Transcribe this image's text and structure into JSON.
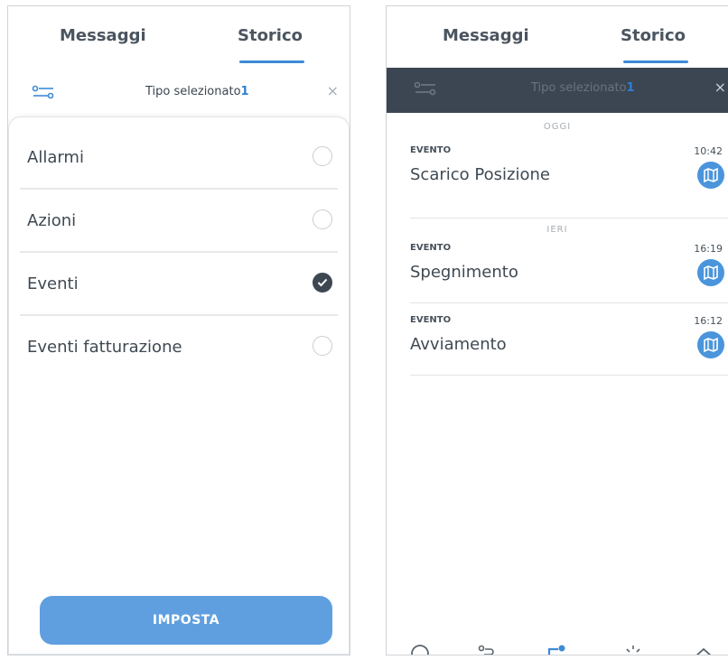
{
  "left": {
    "tabs": [
      {
        "label": "Messaggi"
      },
      {
        "label": "Storico"
      }
    ],
    "filter": {
      "text": "Tipo selezionato",
      "count": "1",
      "close": "×"
    },
    "options": [
      {
        "label": "Allarmi",
        "checked": false
      },
      {
        "label": "Azioni",
        "checked": false
      },
      {
        "label": "Eventi",
        "checked": true
      },
      {
        "label": "Eventi fatturazione",
        "checked": false
      }
    ],
    "button": "IMPOSTA"
  },
  "right": {
    "tabs": [
      {
        "label": "Messaggi"
      },
      {
        "label": "Storico"
      }
    ],
    "filter": {
      "text": "Tipo selezionato",
      "count": "1",
      "close": "×"
    },
    "groups": [
      {
        "day": "OGGI",
        "entries": [
          {
            "type": "EVENTO",
            "time": "10:42",
            "name": "Scarico Posizione"
          }
        ]
      },
      {
        "day": "IERI",
        "entries": [
          {
            "type": "EVENTO",
            "time": "16:19",
            "name": "Spegnimento"
          },
          {
            "type": "EVENTO",
            "time": "16:12",
            "name": "Avviamento"
          }
        ]
      }
    ]
  },
  "colors": {
    "accent": "#3d8bd6",
    "button": "#5f9fdf",
    "dark_bar": "#3c4653"
  },
  "icons": [
    "filter-icon",
    "close-icon",
    "check-icon",
    "map-icon"
  ]
}
